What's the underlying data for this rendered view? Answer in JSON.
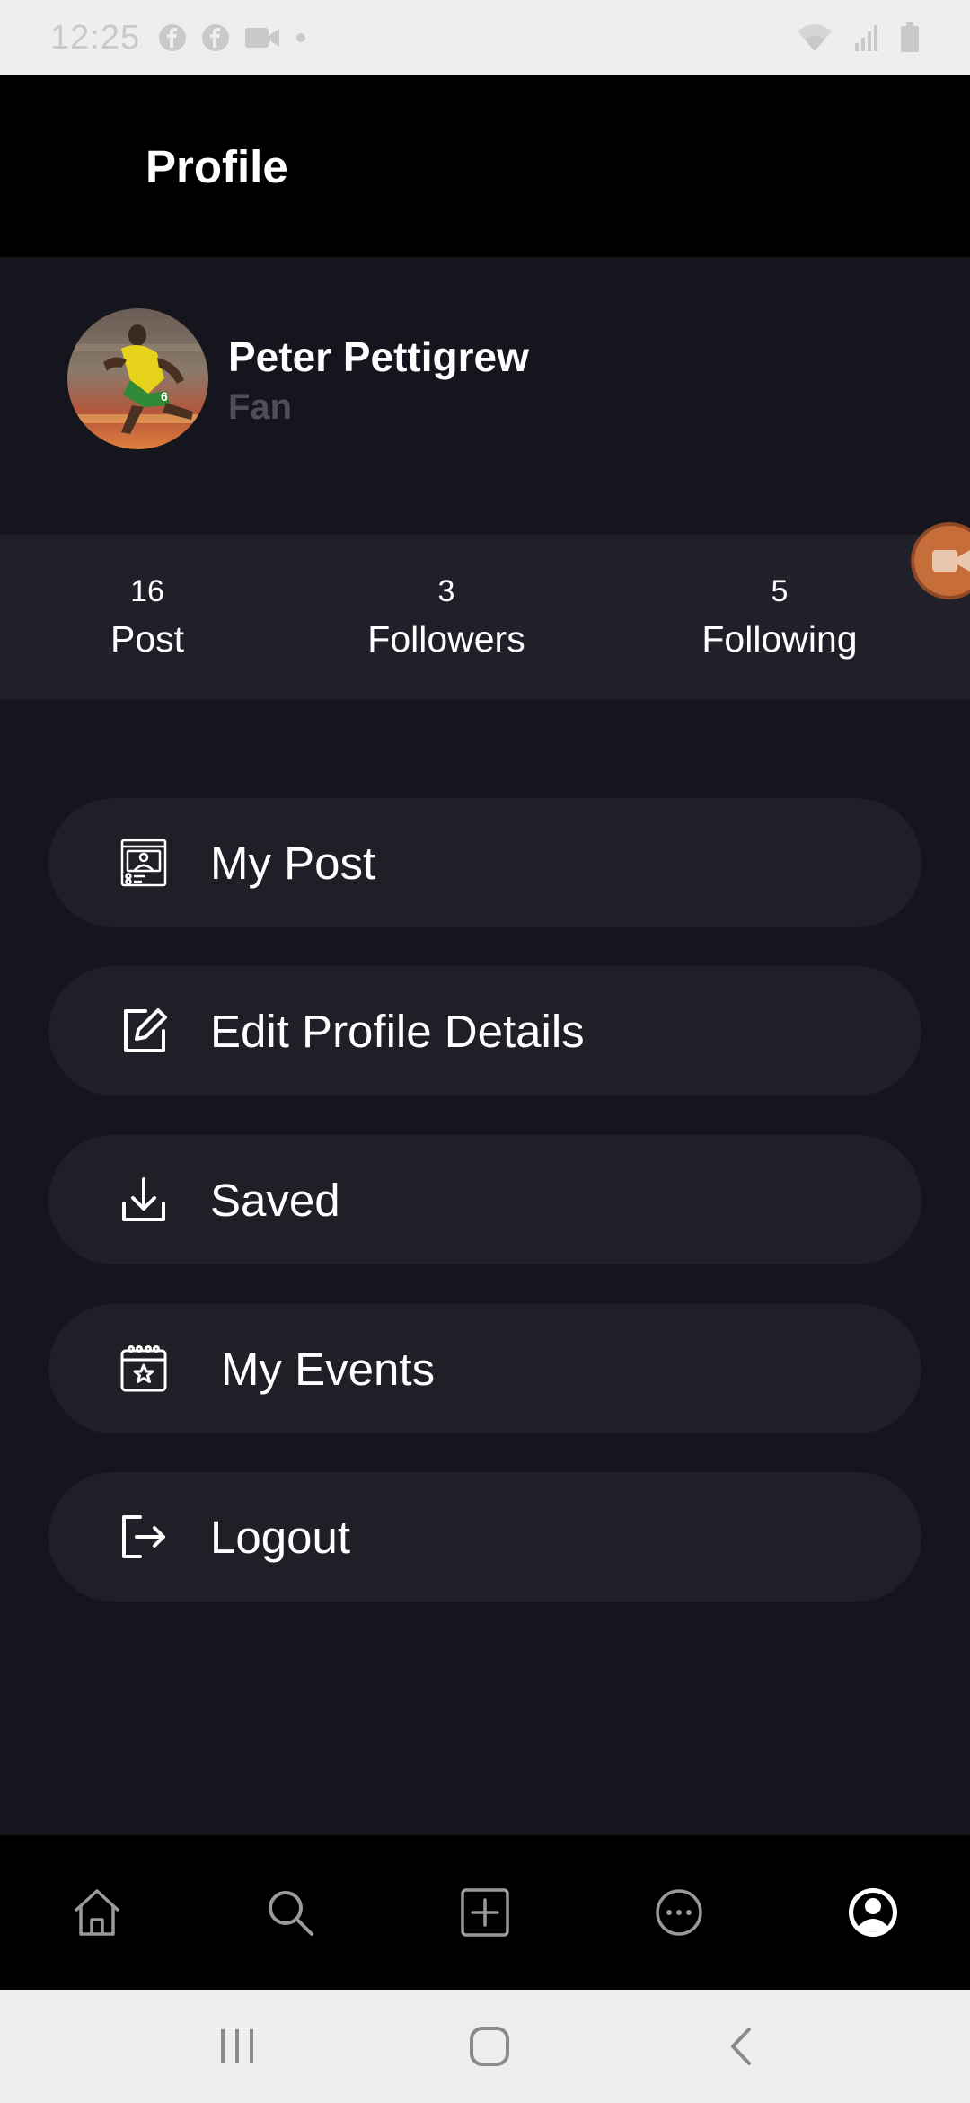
{
  "status_bar": {
    "time": "12:25",
    "notification_icons": [
      "facebook-icon",
      "facebook-icon",
      "video-call-icon",
      "dot-icon"
    ],
    "system_icons": [
      "wifi-icon",
      "signal-icon",
      "battery-icon"
    ]
  },
  "header": {
    "title": "Profile"
  },
  "profile": {
    "name": "Peter Pettigrew",
    "role": "Fan"
  },
  "stats": [
    {
      "count": "16",
      "label": "Post"
    },
    {
      "count": "3",
      "label": "Followers"
    },
    {
      "count": "5",
      "label": "Following"
    }
  ],
  "menu": [
    {
      "label": "My Post",
      "icon": "my-post-icon"
    },
    {
      "label": "Edit Profile Details",
      "icon": "edit-icon"
    },
    {
      "label": "Saved",
      "icon": "download-icon"
    },
    {
      "label": "My Events",
      "icon": "calendar-star-icon"
    },
    {
      "label": "Logout",
      "icon": "logout-icon"
    }
  ],
  "bottom_nav": [
    "home-icon",
    "search-icon",
    "add-icon",
    "more-icon",
    "profile-icon"
  ],
  "colors": {
    "background": "#15151d",
    "header": "#000000",
    "stats_bar": "#20202a",
    "menu_item": "#1f1f27",
    "role_text": "#4e4e58",
    "accent_floating": "#c76d3a"
  }
}
